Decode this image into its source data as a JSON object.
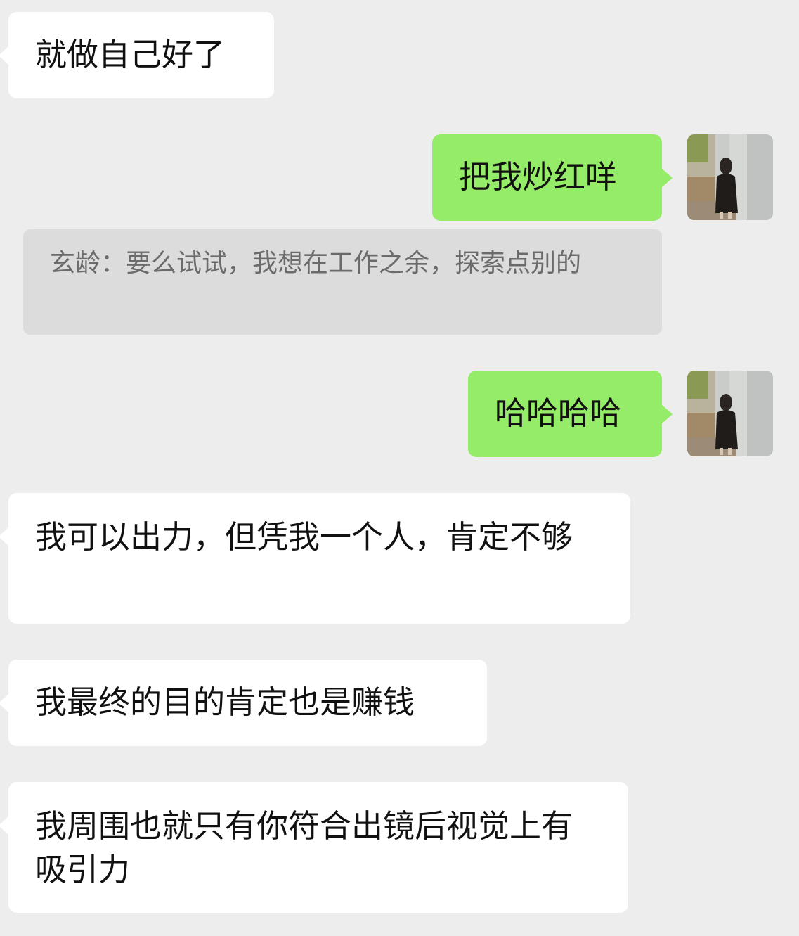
{
  "conversation": {
    "messages": [
      {
        "sender": "other",
        "text": "就做自己好了"
      },
      {
        "sender": "me",
        "text": "把我炒红咩"
      },
      {
        "quote": "玄龄：要么试试，我想在工作之余，探索点别的"
      },
      {
        "sender": "me",
        "text": "哈哈哈哈"
      },
      {
        "sender": "other",
        "text": "我可以出力，但凭我一个人，肯定不够"
      },
      {
        "sender": "other",
        "text": "我最终的目的肯定也是赚钱"
      },
      {
        "sender": "other",
        "text": "我周围也就只有你符合出镜后视觉上有吸引力"
      }
    ]
  },
  "colors": {
    "background": "#ededed",
    "incoming_bubble": "#ffffff",
    "outgoing_bubble": "#95ec69",
    "quote_bubble": "#dcdcdc",
    "quote_text": "#6b6b6b"
  },
  "icons": {
    "avatar": "user-avatar-photo"
  }
}
